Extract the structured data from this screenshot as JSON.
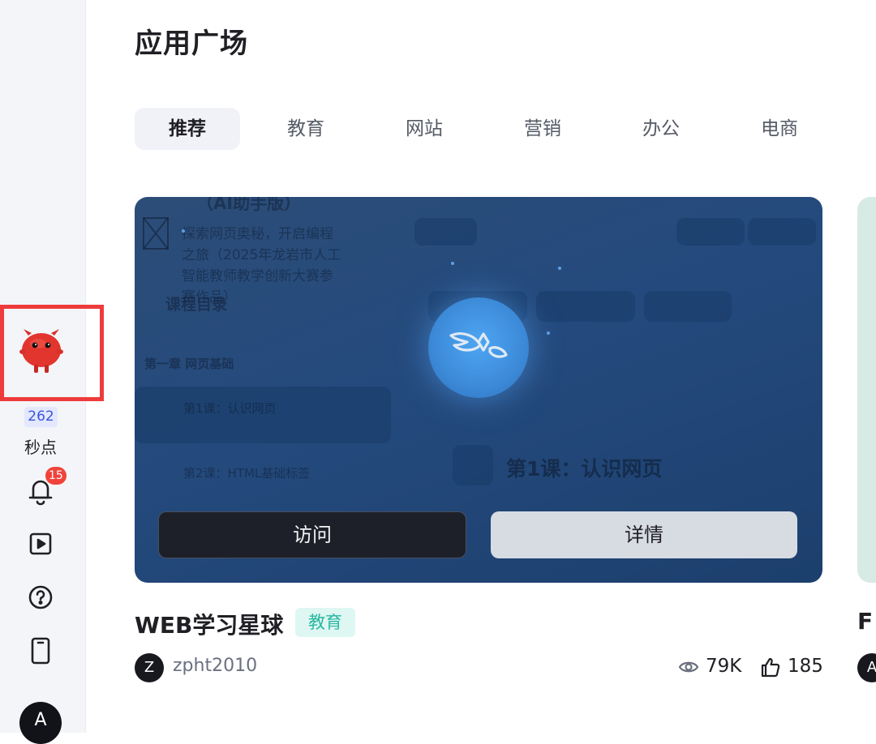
{
  "sidebar": {
    "points_value": "262",
    "points_label": "秒点",
    "notification_count": "15",
    "user_initial": "A"
  },
  "page": {
    "title": "应用广场"
  },
  "tabs": [
    {
      "label": "推荐",
      "active": true
    },
    {
      "label": "教育",
      "active": false
    },
    {
      "label": "网站",
      "active": false
    },
    {
      "label": "营销",
      "active": false
    },
    {
      "label": "办公",
      "active": false
    },
    {
      "label": "电商",
      "active": false
    }
  ],
  "card": {
    "preview_text": {
      "heading": "（AI助手版）",
      "intro": "探索网页奥秘，开启编程之旅（2025年龙岩市人工智能教师教学创新大赛参赛作品）",
      "toc": "课程目录",
      "chapter": "第一章 网页基础",
      "lesson1": "第1课：认识网页",
      "lesson2": "第2课：HTML基础标签",
      "main_heading": "第1课：认识网页"
    },
    "visit_label": "访问",
    "detail_label": "详情",
    "title": "WEB学习星球",
    "tag": "教育",
    "author_initial": "Z",
    "author": "zpht2010",
    "views": "79K",
    "likes": "185"
  },
  "next_card": {
    "title_partial": "F",
    "author_initial": "A"
  },
  "colors": {
    "highlight": "#ee3b3b",
    "tag_bg": "#def7f3",
    "tag_text": "#29b8a2",
    "badge": "#f0433c"
  }
}
